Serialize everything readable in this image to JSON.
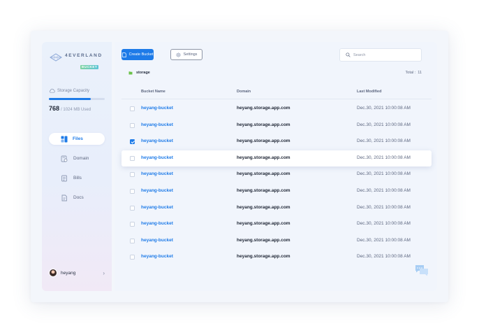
{
  "logo": {
    "word": "4EVERLAND",
    "badge": "BUCKET"
  },
  "storage": {
    "label": "Storage Capacity",
    "used": "768",
    "total_text": "/ 1024 MB Used",
    "fraction": 0.75
  },
  "nav": [
    {
      "label": "Files",
      "icon": "files-icon",
      "active": true
    },
    {
      "label": "Domain",
      "icon": "domain-icon",
      "active": false
    },
    {
      "label": "Bills",
      "icon": "bills-icon",
      "active": false
    },
    {
      "label": "Docs",
      "icon": "docs-icon",
      "active": false
    }
  ],
  "user": {
    "name": "heyang",
    "chevron": "›"
  },
  "toolbar": {
    "create_label": "Create Bucket",
    "settings_label": "Settings",
    "search_placeholder": "Search"
  },
  "breadcrumb": {
    "folder": "storage"
  },
  "total": {
    "label": "Total :",
    "count": "11"
  },
  "table": {
    "columns": [
      "Bucket Name",
      "Domain",
      "Last Modified"
    ],
    "rows": [
      {
        "name": "heyang-bucket",
        "domain": "heyang.storage.app.com",
        "modified": "Dec.30, 2021 10:00:08 AM",
        "checked": false,
        "highlighted": false
      },
      {
        "name": "heyang-bucket",
        "domain": "heyang.storage.app.com",
        "modified": "Dec.30, 2021 10:00:08 AM",
        "checked": false,
        "highlighted": false
      },
      {
        "name": "heyang-bucket",
        "domain": "heyang.storage.app.com",
        "modified": "Dec.30, 2021 10:00:08 AM",
        "checked": true,
        "highlighted": false
      },
      {
        "name": "heyang-bucket",
        "domain": "heyang.storage.app.com",
        "modified": "Dec.30, 2021 10:00:08 AM",
        "checked": false,
        "highlighted": true
      },
      {
        "name": "heyang-bucket",
        "domain": "heyang.storage.app.com",
        "modified": "Dec.30, 2021 10:00:08 AM",
        "checked": false,
        "highlighted": false
      },
      {
        "name": "heyang-bucket",
        "domain": "heyang.storage.app.com",
        "modified": "Dec.30, 2021 10:00:08 AM",
        "checked": false,
        "highlighted": false
      },
      {
        "name": "heyang-bucket",
        "domain": "heyang.storage.app.com",
        "modified": "Dec.30, 2021 10:00:08 AM",
        "checked": false,
        "highlighted": false
      },
      {
        "name": "heyang-bucket",
        "domain": "heyang.storage.app.com",
        "modified": "Dec.30, 2021 10:00:08 AM",
        "checked": false,
        "highlighted": false
      },
      {
        "name": "heyang-bucket",
        "domain": "heyang.storage.app.com",
        "modified": "Dec.30, 2021 10:00:08 AM",
        "checked": false,
        "highlighted": false
      },
      {
        "name": "heyang-bucket",
        "domain": "heyang.storage.app.com",
        "modified": "Dec.30, 2021 10:00:08 AM",
        "checked": false,
        "highlighted": false
      }
    ]
  },
  "colors": {
    "accent": "#1e7be8",
    "text": "#1d2433",
    "muted": "#5d6780",
    "panel": "#f1f5fc"
  }
}
